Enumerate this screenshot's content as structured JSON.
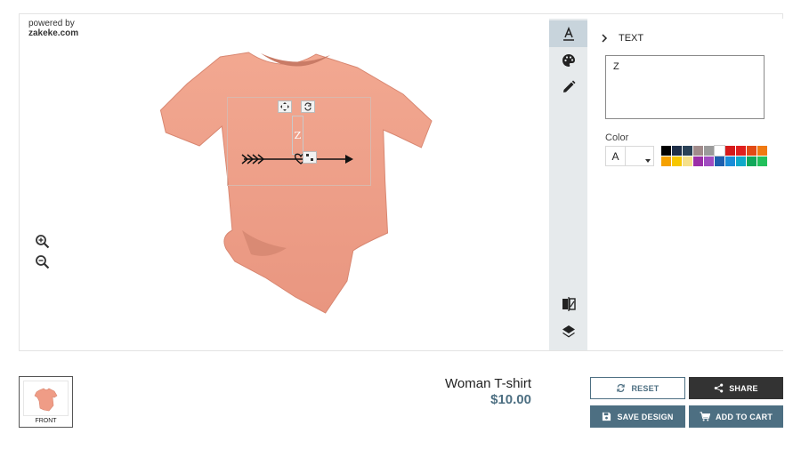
{
  "branding": {
    "powered_by": "powered by",
    "brand": "zakeke.com"
  },
  "toolbar": {
    "tools": [
      {
        "name": "text-tool",
        "icon": "text-format-icon",
        "active": true
      },
      {
        "name": "color-tool",
        "icon": "palette-icon",
        "active": false
      },
      {
        "name": "draw-tool",
        "icon": "pencil-icon",
        "active": false
      }
    ],
    "bottom_tools": [
      {
        "name": "compare-tool",
        "icon": "compare-icon"
      },
      {
        "name": "layers-tool",
        "icon": "layers-icon"
      }
    ]
  },
  "panel": {
    "section_title": "TEXT",
    "text_value": "Z",
    "color_label": "Color",
    "color_picker_letter": "A",
    "swatches": [
      "#000000",
      "#1f2f48",
      "#2a4257",
      "#a18b8b",
      "#9a9a9a",
      "#ffffff",
      "#d61a1a",
      "#e0201e",
      "#e24a15",
      "#f07a12",
      "#f5a100",
      "#f7c700",
      "#f5e08a",
      "#9b2fa8",
      "#a04cc0",
      "#1d5fae",
      "#1a8dd8",
      "#0fa9c9",
      "#10a85a",
      "#22c05c"
    ]
  },
  "canvas": {
    "design_text": "Z"
  },
  "product": {
    "name": "Woman T-shirt",
    "price": "$10.00",
    "side_label": "FRONT"
  },
  "actions": {
    "reset": "RESET",
    "share": "SHARE",
    "save": "SAVE DESIGN",
    "cart": "ADD TO CART"
  },
  "colors": {
    "accent": "#4d6f82",
    "dark": "#333333",
    "toolbar_bg": "#e6eaec",
    "shirt": "#f0a08a"
  }
}
